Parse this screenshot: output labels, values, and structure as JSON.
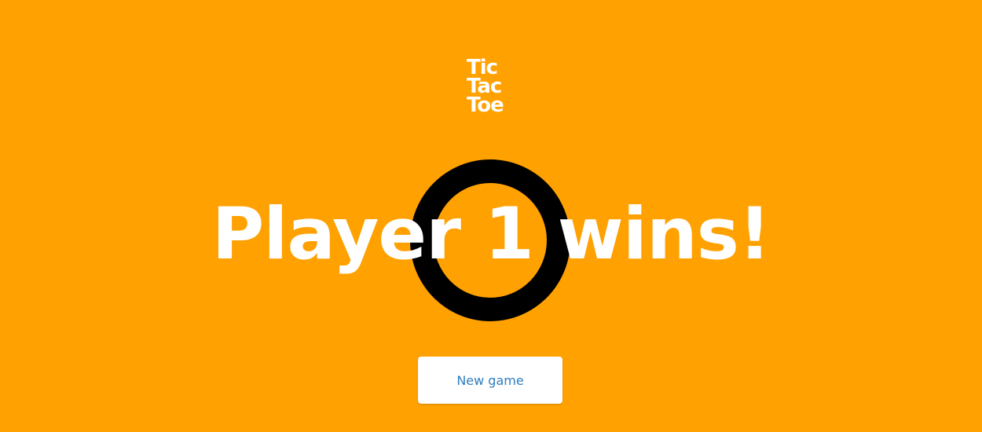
{
  "logo": {
    "lines": [
      "Tic",
      "Tac",
      "Toe"
    ]
  },
  "board": {
    "current_mark": "O",
    "mark_icon": "circle-o-icon"
  },
  "result": {
    "message": "Player 1 wins!"
  },
  "actions": {
    "new_game_label": "New game"
  },
  "colors": {
    "background": "#FFA100",
    "text": "#FFFFFF",
    "mark": "#000000",
    "button_text": "#2D7DC0"
  }
}
